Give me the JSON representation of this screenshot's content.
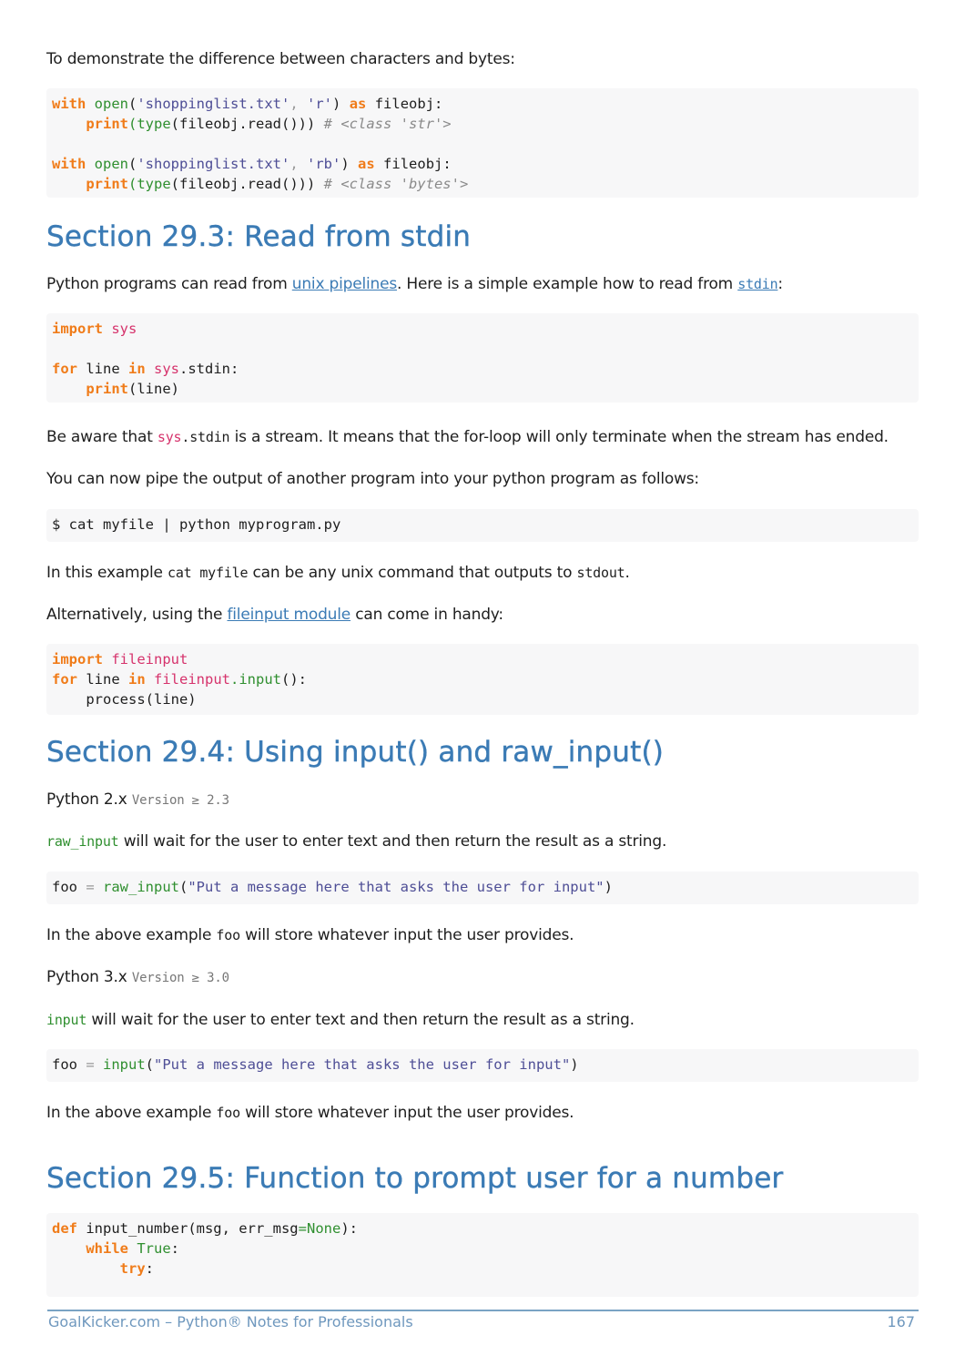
{
  "intro": "To demonstrate the difference between characters and bytes:",
  "code1": {
    "line1": {
      "kw": "with",
      "fn": "open",
      "s1": "'shoppinglist.txt'",
      "s2": "'r'",
      "kw2": "as",
      "var": "fileobj:"
    },
    "line2": {
      "fn": "print",
      "rest": "(type(fileobj.read()))",
      "comment": "# <class 'str'>"
    },
    "line3": {
      "kw": "with",
      "fn": "open",
      "s1": "'shoppinglist.txt'",
      "s2": "'rb'",
      "kw2": "as",
      "var": "fileobj:"
    },
    "line4": {
      "fn": "print",
      "rest": "(type(fileobj.read()))",
      "comment": "# <class 'bytes'>"
    }
  },
  "section_293": {
    "title": "Section 29.3: Read from stdin",
    "p1_pre": "Python programs can read from ",
    "p1_link": "unix pipelines",
    "p1_mid": ". Here is a simple example how to read from ",
    "p1_link2": "stdin",
    "p1_post": ":",
    "code": {
      "import": "import",
      "sys": "sys",
      "for": "for",
      "line": " line ",
      "in": "in",
      "sys2": "sys",
      "stdin": ".stdin:",
      "print": "print",
      "print_arg": "(line)"
    },
    "p2_pre": "Be aware that ",
    "p2_code_mod": "sys",
    "p2_code": ".stdin",
    "p2_post": " is a stream. It means that the for-loop will only terminate when the stream has ended.",
    "p3": "You can now pipe the output of another program into your python program as follows:",
    "shell": "$ cat myfile | python myprogram.py",
    "p4_pre": "In this example ",
    "p4_code": "cat myfile",
    "p4_mid": " can be any unix command that outputs to ",
    "p4_code2": "stdout",
    "p4_post": ".",
    "p5_pre": "Alternatively, using the ",
    "p5_link": "fileinput module",
    "p5_post": " can come in handy:",
    "code2": {
      "import": "import",
      "mod": "fileinput",
      "for": "for",
      "line": " line ",
      "in": "in",
      "mod2": "fileinput",
      "call": ".input",
      "call_end": "():",
      "body": "    process(line)"
    }
  },
  "section_294": {
    "title": "Section 29.4: Using input() and raw_input()",
    "py2_label": "Python 2.x",
    "py2_version": "Version ≥ 2.3",
    "p1_code": "raw_input",
    "p1_text": " will wait for the user to enter text and then return the result as a string.",
    "code1": {
      "var": "foo",
      "eq": " = ",
      "fn": "raw_input",
      "open": "(",
      "str": "\"Put a message here that asks the user for input\"",
      "close": ")"
    },
    "p2_pre": "In the above example ",
    "p2_code": "foo",
    "p2_post": " will store whatever input the user provides.",
    "py3_label": "Python 3.x",
    "py3_version": "Version ≥ 3.0",
    "p3_code": "input",
    "p3_text": " will wait for the user to enter text and then return the result as a string.",
    "code2": {
      "var": "foo",
      "eq": " = ",
      "fn": "input",
      "open": "(",
      "str": "\"Put a message here that asks the user for input\"",
      "close": ")"
    },
    "p4_pre": "In the above example ",
    "p4_code": "foo",
    "p4_post": " will store whatever input the user provides."
  },
  "section_295": {
    "title": "Section 29.5: Function to prompt user for a number",
    "code": {
      "def": "def",
      "sig": " input_number(msg, err_msg",
      "eq": "=",
      "none": "None",
      "sig_end": "):",
      "indent1": "    ",
      "while": "while",
      "true": " True",
      "colon": ":",
      "indent2": "        ",
      "try": "try",
      "colon2": ":"
    }
  },
  "footer": {
    "left": "GoalKicker.com – Python® Notes for Professionals",
    "page": "167"
  }
}
